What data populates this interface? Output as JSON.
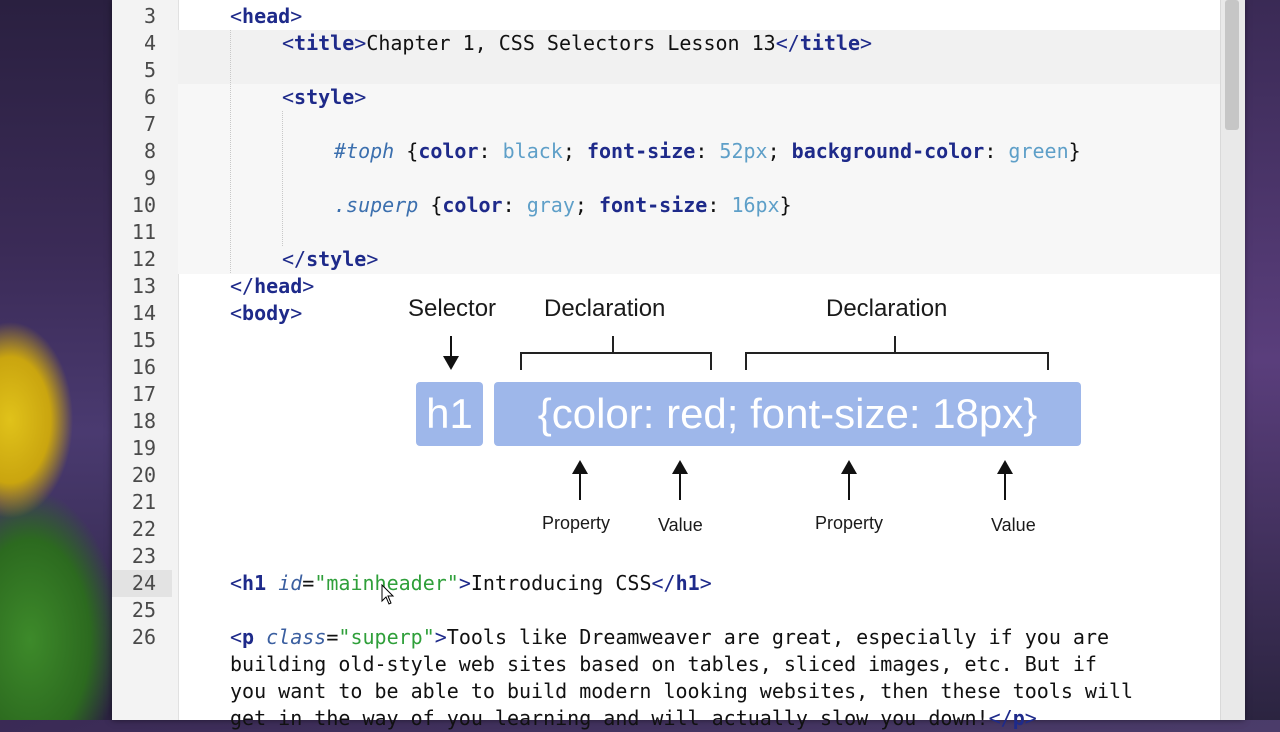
{
  "editor": {
    "lines": [
      {
        "num": "3",
        "code": "<head>"
      },
      {
        "num": "4",
        "code": "<title>Chapter 1, CSS Selectors Lesson 13</title>"
      },
      {
        "num": "5",
        "code": ""
      },
      {
        "num": "6",
        "code": "<style>"
      },
      {
        "num": "7",
        "code": ""
      },
      {
        "num": "8",
        "code": "#toph {color: black; font-size: 52px; background-color: green}"
      },
      {
        "num": "9",
        "code": ""
      },
      {
        "num": "10",
        "code": ".superp {color: gray; font-size: 16px}"
      },
      {
        "num": "11",
        "code": ""
      },
      {
        "num": "12",
        "code": "</style>"
      },
      {
        "num": "13",
        "code": "</head>"
      },
      {
        "num": "14",
        "code": "<body>"
      },
      {
        "num": "15",
        "code": ""
      },
      {
        "num": "16",
        "code": ""
      },
      {
        "num": "17",
        "code": ""
      },
      {
        "num": "18",
        "code": ""
      },
      {
        "num": "19",
        "code": ""
      },
      {
        "num": "20",
        "code": ""
      },
      {
        "num": "21",
        "code": ""
      },
      {
        "num": "22",
        "code": ""
      },
      {
        "num": "23",
        "code": ""
      },
      {
        "num": "24",
        "code": "<h1 id=\"mainheader\">Introducing CSS</h1>"
      },
      {
        "num": "25",
        "code": ""
      },
      {
        "num": "26",
        "code": "<p class=\"superp\">Tools like Dreamweaver are great, especially if you are"
      },
      {
        "num": "",
        "code": "building old-style web sites based on tables, sliced images, etc. But if"
      },
      {
        "num": "",
        "code": "you want to be able to build modern looking websites, then these tools will"
      },
      {
        "num": "",
        "code": "get in the way of you learning and will actually slow you down!</p>"
      }
    ],
    "current_line": "24"
  },
  "diagram": {
    "selector_label": "Selector",
    "declaration_label_1": "Declaration",
    "declaration_label_2": "Declaration",
    "selector_box": "h1",
    "declaration_box": "{color: red; font-size: 18px}",
    "property_label_1": "Property",
    "value_label_1": "Value",
    "property_label_2": "Property",
    "value_label_2": "Value",
    "box_color": "#9eb7ea"
  }
}
